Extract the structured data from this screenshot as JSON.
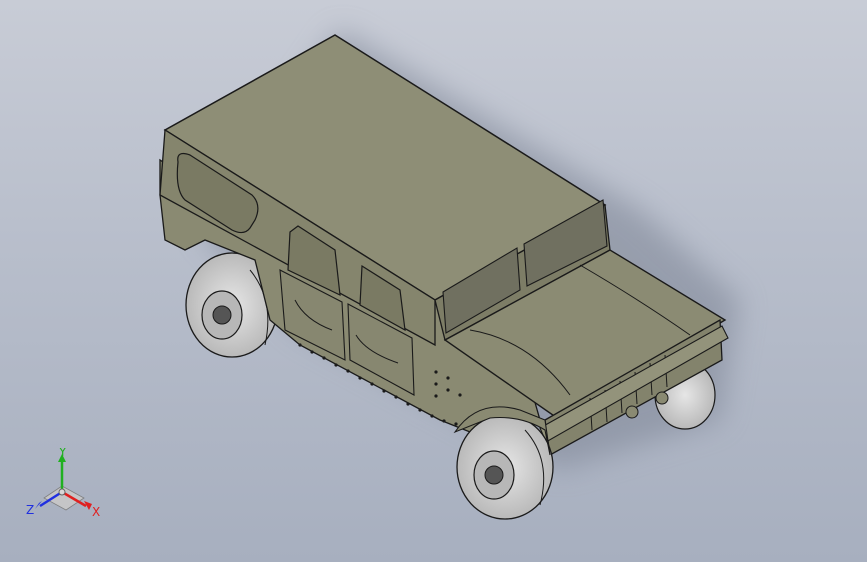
{
  "viewport": {
    "background_top": "#c8ccd6",
    "background_bottom": "#a7afbf"
  },
  "model": {
    "icon": "humvee-3d-model",
    "body_color": "#8a8a72",
    "roof_color": "#8e8e76",
    "dark_color": "#6f6f5c",
    "tire_color": "#cfcfcf",
    "edge_color": "#1a1a1a"
  },
  "triad": {
    "x_label": "X",
    "y_label": "Y",
    "z_label": "Z",
    "x_color": "#e02020",
    "y_color": "#20b020",
    "z_color": "#2030e0"
  }
}
